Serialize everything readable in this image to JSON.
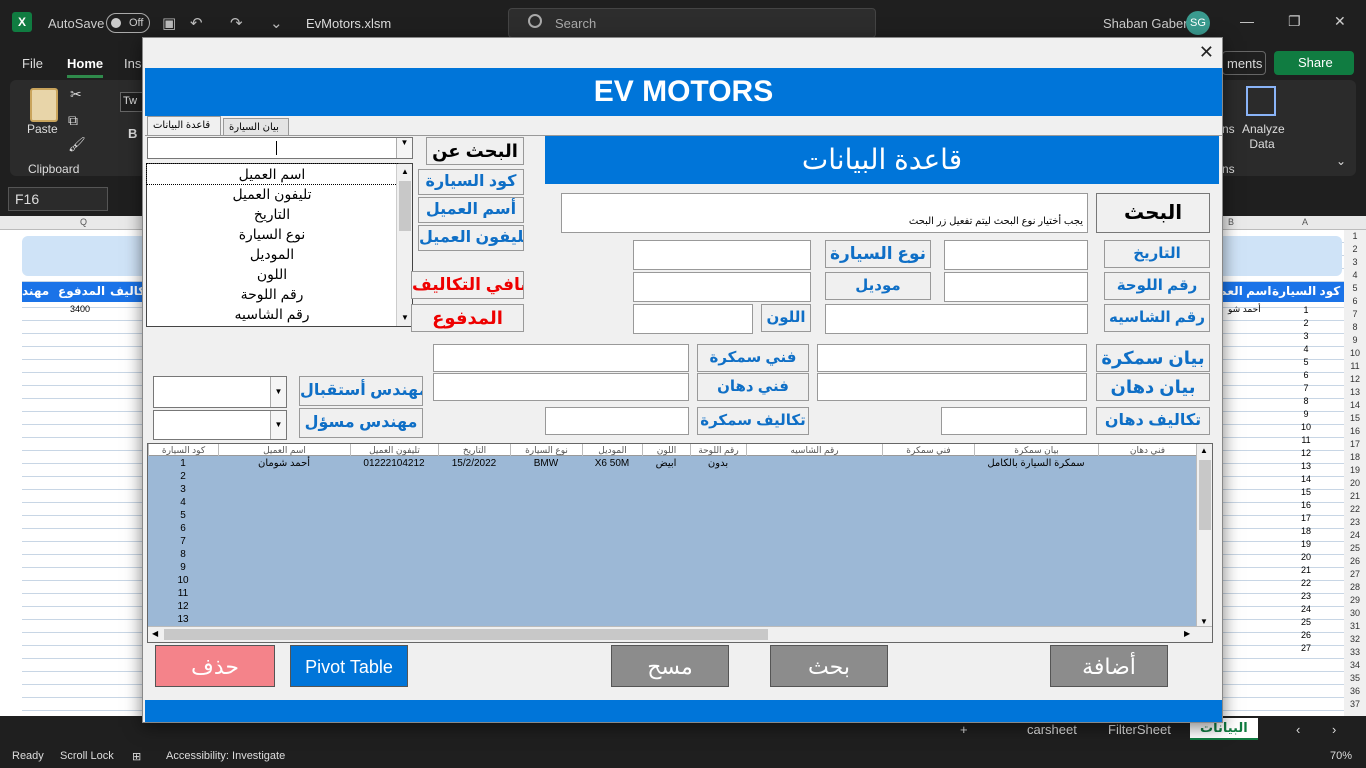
{
  "excel": {
    "autosave": "AutoSave",
    "autosave_state": "Off",
    "filename": "EvMotors.xlsm",
    "search": "Search",
    "user": "Shaban Gaber",
    "initials": "SG",
    "tabs": [
      "File",
      "Home",
      "Inse"
    ],
    "comments": "ments",
    "share": "Share",
    "paste": "Paste",
    "clipboard": "Clipboard",
    "font_box": "Tw",
    "bold": "B",
    "ons": "ns",
    "ons2": "ns",
    "analyze": "Analyze Data",
    "namebox": "F16",
    "col_q": "Q",
    "col_b": "B",
    "col_a": "A",
    "sheet_headers": [
      "كود السيارة",
      "اسم العم",
      "مهند",
      "المدفوع",
      "تكاليف"
    ],
    "paid_cell": "3400",
    "name_cell": "أحمد شو",
    "sheet_tabs": [
      "البيانات",
      "carsheet",
      "FilterSheet"
    ],
    "status": [
      "Ready",
      "Scroll Lock",
      "Accessibility: Investigate"
    ],
    "zoom": "70%"
  },
  "form": {
    "title": "EV MOTORS",
    "tabs": [
      "قاعدة البيانات",
      "بيان السيارة"
    ],
    "header": "قاعدة البيانات",
    "search_btn": "البحث",
    "search_hint": "يجب أختيار نوع البحث ليتم تفعيل زر البحث",
    "search_by": "البحث عن",
    "search_by_options": [
      "كود السيارة",
      "أسم العميل",
      "تليفون العميل"
    ],
    "net_cost": "صافي التكاليف",
    "paid": "المدفوع",
    "dropdown_items": [
      "اسم العميل",
      "تليفون العميل",
      "التاريخ",
      "نوع السيارة",
      "الموديل",
      "اللون",
      "رقم اللوحة",
      "رقم الشاسيه"
    ],
    "labels": {
      "date": "التاريخ",
      "car_type": "نوع السيارة",
      "plate": "رقم اللوحة",
      "model": "موديل",
      "chassis": "رقم الشاسيه",
      "color": "اللون",
      "body_desc": "بيان سمكرة",
      "body_tech": "فني سمكرة",
      "paint_desc": "بيان دهان",
      "paint_tech": "فني دهان",
      "paint_cost": "تكاليف دهان",
      "body_cost": "تكاليف سمكرة",
      "reception_eng": "مهندس أستقبال",
      "resp_eng": "مهندس مسؤل"
    },
    "list_headers": [
      "كود السيارة",
      "اسم العميل",
      "تليفون العميل",
      "التاريخ",
      "نوع السيارة",
      "الموديل",
      "اللون",
      "رقم اللوحة",
      "رقم الشاسيه",
      "فني سمكرة",
      "بيان سمكرة",
      "فني دهان"
    ],
    "list_first_row": {
      "code": "1",
      "name": "أحمد شومان",
      "phone": "01222104212",
      "date": "15/2/2022",
      "car": "BMW",
      "model": "X6 50M",
      "color": "ابيض",
      "plate": "بدون",
      "body_desc": "سمكرة السيارة بالكامل"
    },
    "list_codes": [
      "2",
      "3",
      "4",
      "5",
      "6",
      "7",
      "8",
      "9",
      "10",
      "11",
      "12",
      "13"
    ],
    "buttons": {
      "delete": "حذف",
      "pivot": "Pivot Table",
      "clear": "مسح",
      "search": "بحث",
      "add": "أضافة"
    },
    "colors": {
      "blue": "#0075d9",
      "delete": "#f4838a",
      "grey": "#8c8c8c"
    }
  }
}
